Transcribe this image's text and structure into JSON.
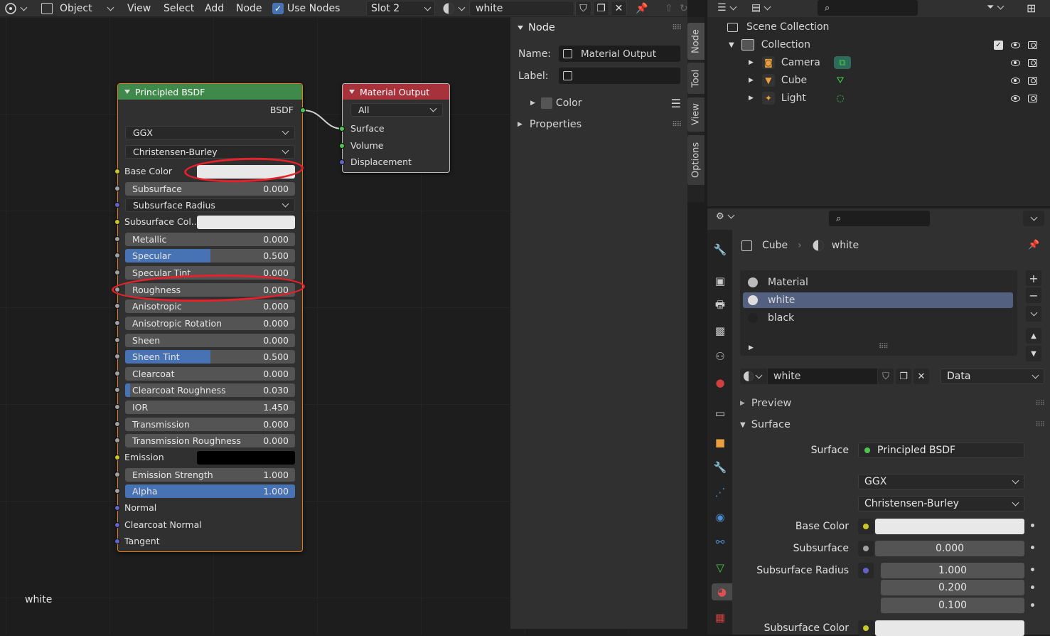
{
  "header": {
    "mode": "Object",
    "menus": [
      "View",
      "Select",
      "Add",
      "Node"
    ],
    "use_nodes_label": "Use Nodes",
    "slot": "Slot 2",
    "material": "white"
  },
  "principled_node": {
    "title": "Principled BSDF",
    "output": "BSDF",
    "distribution": "GGX",
    "subsurface_method": "Christensen-Burley",
    "inputs": [
      {
        "label": "Base Color",
        "kind": "color",
        "color": "#e8e8e8",
        "socket": "#c7c729"
      },
      {
        "label": "Subsurface",
        "value": "0.000",
        "fill": 0,
        "socket": "#a1a1a1"
      },
      {
        "label": "Subsurface Radius",
        "kind": "select",
        "socket": "#6363c7"
      },
      {
        "label": "Subsurface Col...",
        "kind": "color",
        "color": "#e8e8e8",
        "socket": "#c7c729"
      },
      {
        "label": "Metallic",
        "value": "0.000",
        "fill": 0,
        "socket": "#a1a1a1"
      },
      {
        "label": "Specular",
        "value": "0.500",
        "fill": 0.5,
        "socket": "#a1a1a1"
      },
      {
        "label": "Specular Tint",
        "value": "0.000",
        "fill": 0,
        "socket": "#a1a1a1"
      },
      {
        "label": "Roughness",
        "value": "0.000",
        "fill": 0,
        "socket": "#a1a1a1"
      },
      {
        "label": "Anisotropic",
        "value": "0.000",
        "fill": 0,
        "socket": "#a1a1a1"
      },
      {
        "label": "Anisotropic Rotation",
        "value": "0.000",
        "fill": 0,
        "socket": "#a1a1a1"
      },
      {
        "label": "Sheen",
        "value": "0.000",
        "fill": 0,
        "socket": "#a1a1a1"
      },
      {
        "label": "Sheen Tint",
        "value": "0.500",
        "fill": 0.5,
        "socket": "#a1a1a1"
      },
      {
        "label": "Clearcoat",
        "value": "0.000",
        "fill": 0,
        "socket": "#a1a1a1"
      },
      {
        "label": "Clearcoat Roughness",
        "value": "0.030",
        "fill": 0.03,
        "socket": "#a1a1a1"
      },
      {
        "label": "IOR",
        "value": "1.450",
        "fill": 0,
        "socket": "#a1a1a1"
      },
      {
        "label": "Transmission",
        "value": "0.000",
        "fill": 0,
        "socket": "#a1a1a1"
      },
      {
        "label": "Transmission Roughness",
        "value": "0.000",
        "fill": 0,
        "socket": "#a1a1a1"
      },
      {
        "label": "Emission",
        "kind": "color",
        "color": "#000000",
        "socket": "#c7c729"
      },
      {
        "label": "Emission Strength",
        "value": "1.000",
        "fill": 0,
        "socket": "#a1a1a1"
      },
      {
        "label": "Alpha",
        "value": "1.000",
        "fill": 1,
        "socket": "#a1a1a1"
      },
      {
        "label": "Normal",
        "kind": "plain",
        "socket": "#6363c7"
      },
      {
        "label": "Clearcoat Normal",
        "kind": "plain",
        "socket": "#6363c7"
      },
      {
        "label": "Tangent",
        "kind": "plain",
        "socket": "#6363c7"
      }
    ]
  },
  "output_node": {
    "title": "Material Output",
    "target": "All",
    "inputs": [
      "Surface",
      "Volume",
      "Displacement"
    ]
  },
  "editor_label": "white",
  "npanel": {
    "section": "Node",
    "name_label": "Name:",
    "name_value": "Material Output",
    "label_label": "Label:",
    "color_label": "Color",
    "properties_label": "Properties",
    "tabs": [
      "Node",
      "Tool",
      "View",
      "Options"
    ]
  },
  "outliner": {
    "root": "Scene Collection",
    "collection": "Collection",
    "items": [
      "Camera",
      "Cube",
      "Light"
    ]
  },
  "properties": {
    "object": "Cube",
    "material": "white",
    "slots": [
      "Material",
      "white",
      "black"
    ],
    "mat_field": "white",
    "link": "Data",
    "preview_label": "Preview",
    "surface_section": "Surface",
    "surface_label": "Surface",
    "surface_value": "Principled BSDF",
    "distribution": "GGX",
    "subsurface_method": "Christensen-Burley",
    "base_color_label": "Base Color",
    "subsurface_label": "Subsurface",
    "subsurface_value": "0.000",
    "radius_label": "Subsurface Radius",
    "radius_values": [
      "1.000",
      "0.200",
      "0.100"
    ],
    "subsurface_color_label": "Subsurface Color"
  }
}
